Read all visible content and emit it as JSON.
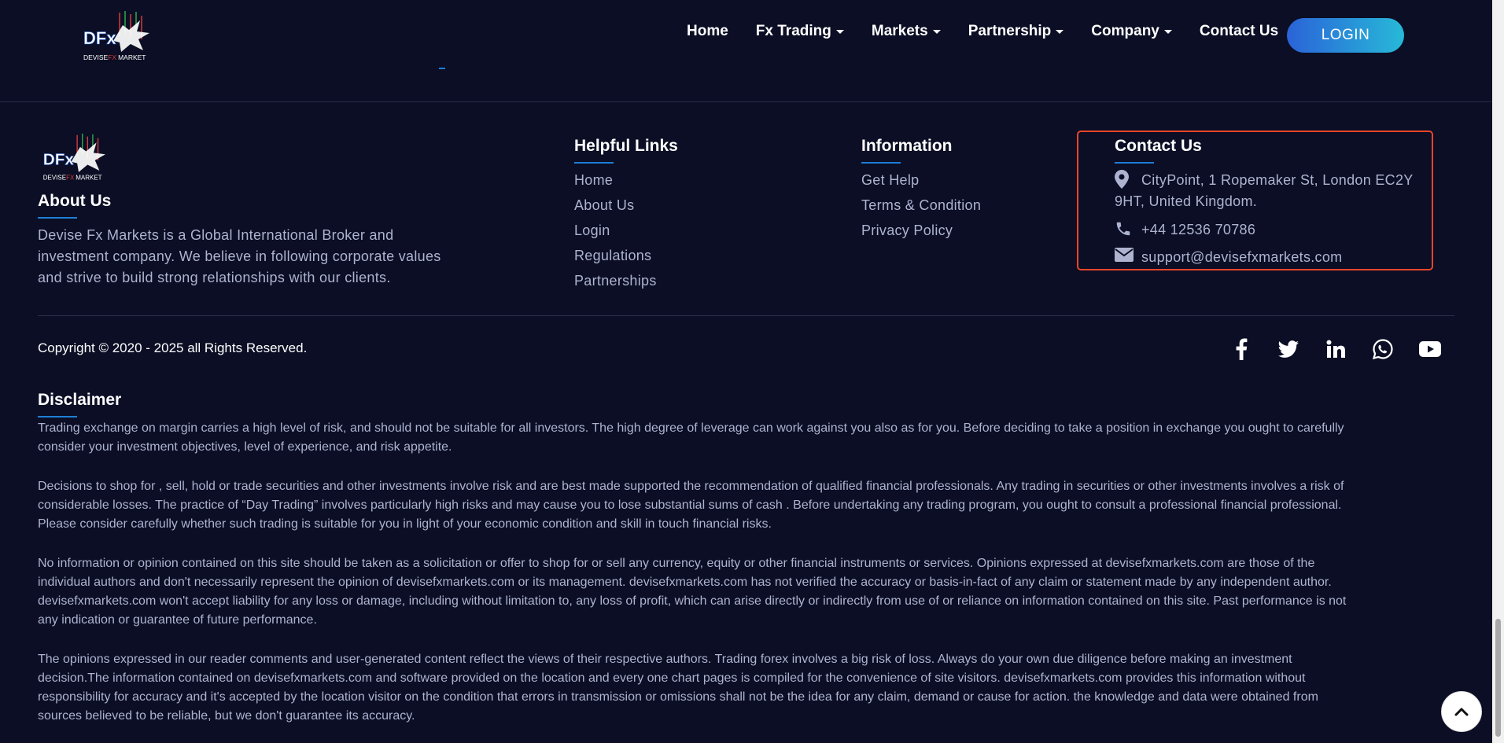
{
  "brand": {
    "logo_initials": "DFx",
    "logo_word_left": "DEVISE",
    "logo_word_fx": "FX",
    "logo_word_right": "MARKET",
    "colors": {
      "background": "#0b0e24",
      "accent_blue": "#1e7fd6",
      "highlight_red": "#e8452c",
      "muted_text": "#aeb3d0"
    }
  },
  "nav": {
    "items": [
      {
        "label": "Home",
        "dropdown": false
      },
      {
        "label": "Fx Trading",
        "dropdown": true
      },
      {
        "label": "Markets",
        "dropdown": true
      },
      {
        "label": "Partnership",
        "dropdown": true
      },
      {
        "label": "Company",
        "dropdown": true
      },
      {
        "label": "Contact Us",
        "dropdown": false
      }
    ],
    "login_label": "LOGIN"
  },
  "about": {
    "title": "About Us",
    "lines": [
      "Devise Fx Markets is a Global International Broker and",
      "investment company. We believe in following corporate values",
      "and strive to build strong relationships with our clients."
    ]
  },
  "helpful_links": {
    "title": "Helpful Links",
    "links": [
      "Home",
      "About Us",
      "Login",
      "Regulations",
      "Partnerships"
    ]
  },
  "information": {
    "title": "Information",
    "links": [
      "Get Help",
      "Terms & Condition",
      "Privacy Policy"
    ]
  },
  "contact": {
    "title": "Contact Us",
    "address_line1": "CityPoint, 1 Ropemaker St, London EC2Y",
    "address_line2": "9HT, United Kingdom.",
    "phone": "+44 12536 70786",
    "email": "support@devisefxmarkets.com",
    "icons": [
      "map-marker-icon",
      "phone-icon",
      "envelope-icon"
    ]
  },
  "copyright": "Copyright © 2020 - 2025 all Rights Reserved.",
  "social_icons": [
    "facebook-icon",
    "twitter-icon",
    "linkedin-icon",
    "whatsapp-icon",
    "youtube-icon"
  ],
  "disclaimer": {
    "title": "Disclaimer",
    "paragraphs": [
      [
        "Trading exchange on margin carries a high level of risk, and should not be suitable for all investors. The high degree of leverage can work against you also as for you. Before deciding to take a position in exchange you ought to carefully",
        "consider your investment objectives, level of experience, and risk appetite."
      ],
      [
        "Decisions to shop for , sell, hold or trade securities and other investments involve risk and are best made supported the recommendation of qualified financial professionals. Any trading in securities or other investments involves a risk of",
        "considerable losses. The practice of “Day Trading” involves particularly high risks and may cause you to lose substantial sums of cash . Before undertaking any trading program, you ought to consult a professional financial professional.",
        "Please consider carefully whether such trading is suitable for you in light of your economic condition and skill in touch financial risks."
      ],
      [
        "No information or opinion contained on this site should be taken as a solicitation or offer to shop for or sell any currency, equity or other financial instruments or services. Opinions expressed at devisefxmarkets.com are those of the",
        "individual authors and don't necessarily represent the opinion of devisefxmarkets.com or its management. devisefxmarkets.com has not verified the accuracy or basis-in-fact of any claim or statement made by any independent author.",
        "devisefxmarkets.com won't accept liability for any loss or damage, including without limitation to, any loss of profit, which can arise directly or indirectly from use of or reliance on information contained on this site. Past performance is not",
        "any indication or guarantee of future performance."
      ],
      [
        "The opinions expressed in our reader comments and user-generated content reflect the views of their respective authors. Trading forex involves a big risk of loss. Always do your own due diligence before making an investment",
        "decision.The information contained on devisefxmarkets.com and software provided on the location and every one chart pages is compiled for the convenience of site visitors. devisefxmarkets.com provides this information without",
        "responsibility for accuracy and it's accepted by the location visitor on the condition that errors in transmission or omissions shall not be the idea for any claim, demand or cause for action. the knowledge and data were obtained from",
        "sources believed to be reliable, but we don't guarantee its accuracy."
      ]
    ]
  },
  "scroll_to_top_icon": "chevron-up-icon"
}
